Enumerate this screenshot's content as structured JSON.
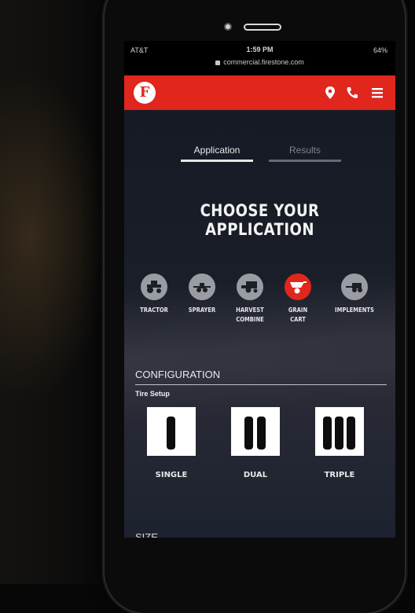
{
  "status_bar": {
    "carrier": "AT&T",
    "time": "1:59 PM",
    "battery": "64%",
    "url": "commercial.firestone.com"
  },
  "header": {
    "logo_letter": "F",
    "icons": [
      "location-pin-icon",
      "phone-icon",
      "hamburger-menu-icon"
    ],
    "brand_color": "#e0261d"
  },
  "tabs": [
    {
      "label": "Application",
      "active": true
    },
    {
      "label": "Results",
      "active": false
    }
  ],
  "headline": "CHOOSE YOUR APPLICATION",
  "applications": [
    {
      "line1": "TRACTOR",
      "line2": "",
      "selected": false,
      "icon": "tractor-icon"
    },
    {
      "line1": "SPRAYER",
      "line2": "",
      "selected": false,
      "icon": "sprayer-icon"
    },
    {
      "line1": "HARVEST",
      "line2": "COMBINE",
      "selected": false,
      "icon": "combine-icon"
    },
    {
      "line1": "GRAIN",
      "line2": "CART",
      "selected": true,
      "icon": "grain-cart-icon"
    },
    {
      "line1": "IMPLEMENTS",
      "line2": "",
      "selected": false,
      "icon": "implements-icon"
    }
  ],
  "configuration": {
    "title": "CONFIGURATION",
    "tire_setup_label": "Tire Setup",
    "options": [
      {
        "label": "SINGLE",
        "tires": 1
      },
      {
        "label": "DUAL",
        "tires": 2
      },
      {
        "label": "TRIPLE",
        "tires": 3
      }
    ]
  },
  "next_section_partial": "SIZE"
}
